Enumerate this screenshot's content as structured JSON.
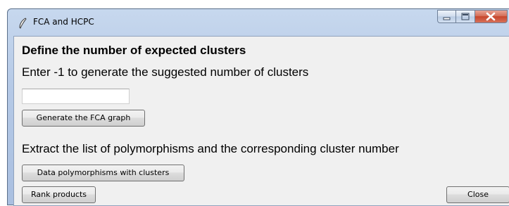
{
  "window": {
    "title": "FCA and HCPC",
    "app_icon": "feather-icon",
    "controls": {
      "minimize": "minimize-icon",
      "maximize": "maximize-icon",
      "close": "close-icon"
    }
  },
  "main": {
    "heading": "Define the number of expected clusters",
    "instruction": "Enter -1 to generate the suggested number of clusters",
    "clusters_input": {
      "value": "",
      "placeholder": ""
    },
    "generate_button": "Generate the FCA graph",
    "extract_label": "Extract the list of polymorphisms and the corresponding cluster number",
    "data_button": "Data polymorphisms with clusters",
    "rank_button": "Rank products",
    "close_button": "Close"
  },
  "colors": {
    "titlebar": "#b5c9e6",
    "client": "#f0f0f0",
    "close_control": "#c7452b"
  }
}
